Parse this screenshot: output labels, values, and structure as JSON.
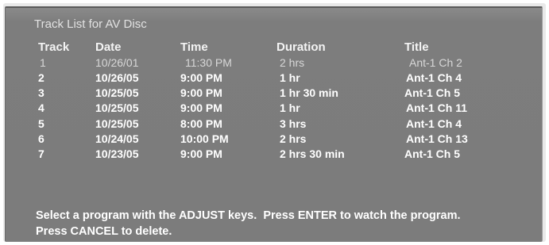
{
  "window": {
    "title": "Track List for AV Disc"
  },
  "table": {
    "headers": {
      "track": "Track",
      "date": "Date",
      "time": "Time",
      "duration": "Duration",
      "title": "Title"
    },
    "rows": [
      {
        "track": "1",
        "date": "10/26/01",
        "time": "11:30 PM",
        "duration": "2 hrs",
        "title": "Ant-1 Ch 2"
      },
      {
        "track": "2",
        "date": "10/26/05",
        "time": "9:00 PM",
        "duration": "1 hr",
        "title": "Ant-1 Ch 4"
      },
      {
        "track": "3",
        "date": "10/25/05",
        "time": "9:00 PM",
        "duration": "1 hr 30 min",
        "title": "Ant-1 Ch 5"
      },
      {
        "track": "4",
        "date": "10/25/05",
        "time": "9:00 PM",
        "duration": "1 hr",
        "title": "Ant-1 Ch 11"
      },
      {
        "track": "5",
        "date": "10/25/05",
        "time": "8:00 PM",
        "duration": "3 hrs",
        "title": "Ant-1 Ch 4"
      },
      {
        "track": "6",
        "date": "10/24/05",
        "time": "10:00 PM",
        "duration": "2 hrs",
        "title": "Ant-1 Ch 13"
      },
      {
        "track": "7",
        "date": "10/23/05",
        "time": "9:00 PM",
        "duration": "2 hrs 30 min",
        "title": "Ant-1 Ch 5"
      }
    ]
  },
  "footer": {
    "line1": "Select a program with the ADJUST keys.  Press ENTER to watch the program.",
    "line2": "Press CANCEL to delete."
  }
}
